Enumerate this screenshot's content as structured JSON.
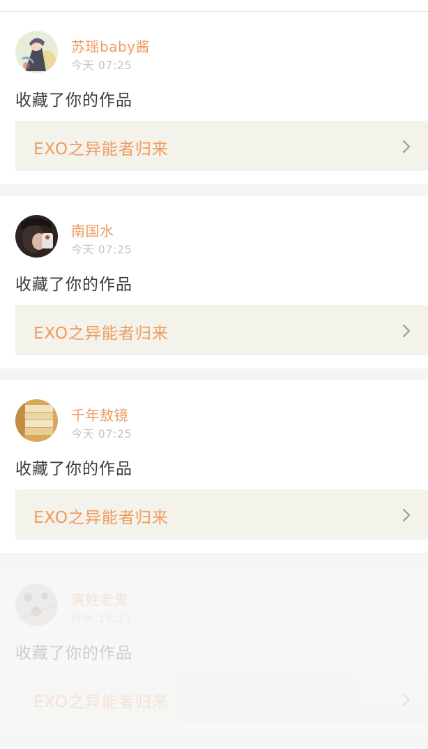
{
  "notifications": [
    {
      "username": "苏瑶baby酱",
      "time": "今天 07:25",
      "action": "收藏了你的作品",
      "work_title": "EXO之异能者归来",
      "avatar_icon": "avatar-illustration-girl"
    },
    {
      "username": "南国水",
      "time": "今天 07:25",
      "action": "收藏了你的作品",
      "work_title": "EXO之异能者归来",
      "avatar_icon": "avatar-photo-person"
    },
    {
      "username": "千年敖镜",
      "time": "今天 07:25",
      "action": "收藏了你的作品",
      "work_title": "EXO之异能者归来",
      "avatar_icon": "avatar-books"
    },
    {
      "username": "寅姓老鬼",
      "time": "昨天 18:33",
      "action": "收藏了你的作品",
      "work_title": "EXO之异能者归来",
      "avatar_icon": "avatar-pattern"
    }
  ],
  "colors": {
    "accent": "#f09a5c",
    "card_link_bg": "#f3f3ec",
    "text": "#3a3a3a",
    "muted": "#c4c4c4"
  }
}
